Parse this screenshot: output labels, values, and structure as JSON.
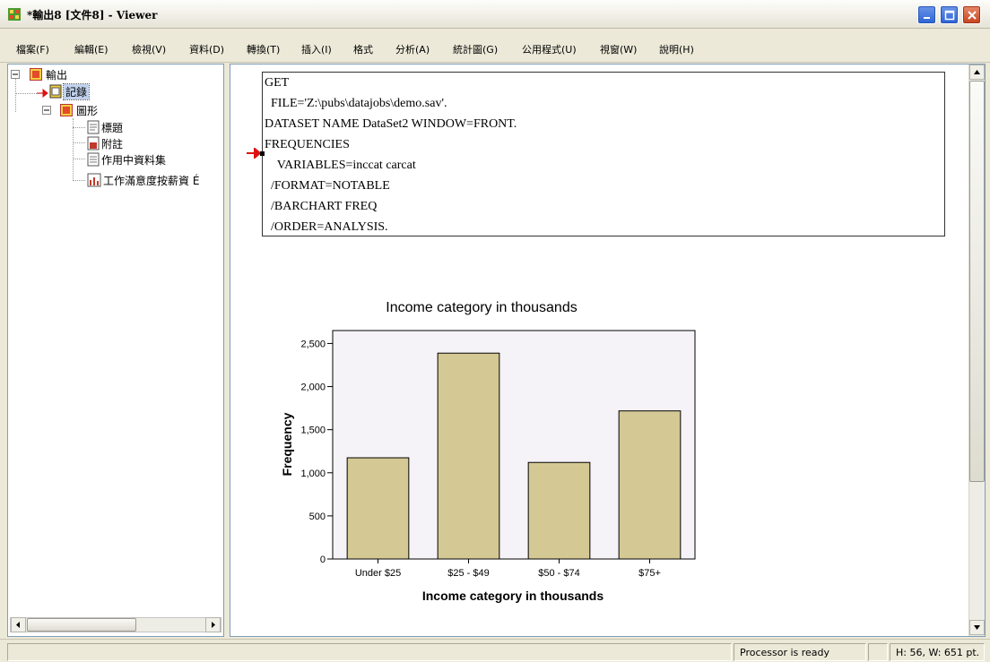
{
  "window": {
    "title": "*輸出8 [文件8] - Viewer"
  },
  "menu": [
    "檔案(F)",
    "編輯(E)",
    "檢視(V)",
    "資料(D)",
    "轉換(T)",
    "插入(I)",
    "格式",
    "分析(A)",
    "統計圖(G)",
    "公用程式(U)",
    "視窗(W)",
    "說明(H)"
  ],
  "tree": {
    "root": "輸出",
    "log": "記錄",
    "graph": "圖形",
    "items": [
      "標題",
      "附註",
      "作用中資料集",
      "工作滿意度按薪資 É"
    ]
  },
  "syntax": {
    "lines": [
      "GET",
      "  FILE='Z:\\pubs\\datajobs\\demo.sav'.",
      "DATASET NAME DataSet2 WINDOW=FRONT.",
      "FREQUENCIES",
      "    VARIABLES=inccat carcat",
      "  /FORMAT=NOTABLE",
      "  /BARCHART FREQ",
      "  /ORDER=ANALYSIS."
    ]
  },
  "chart_data": {
    "type": "bar",
    "title": "Income category in thousands",
    "xlabel": "Income category in thousands",
    "ylabel": "Frequency",
    "categories": [
      "Under $25",
      "$25 - $49",
      "$50 - $74",
      "$75+"
    ],
    "values": [
      1174,
      2388,
      1120,
      1718
    ],
    "ylim": [
      0,
      2650
    ],
    "yticks": [
      0,
      500,
      1000,
      1500,
      2000,
      2500
    ],
    "ytick_labels": [
      "0",
      "500",
      "1,000",
      "1,500",
      "2,000",
      "2,500"
    ],
    "bar_color": "#d4c994",
    "plot_bg": "#f6f3f8"
  },
  "status": {
    "processor": "Processor is ready",
    "dims": "H: 56, W: 651 pt."
  }
}
